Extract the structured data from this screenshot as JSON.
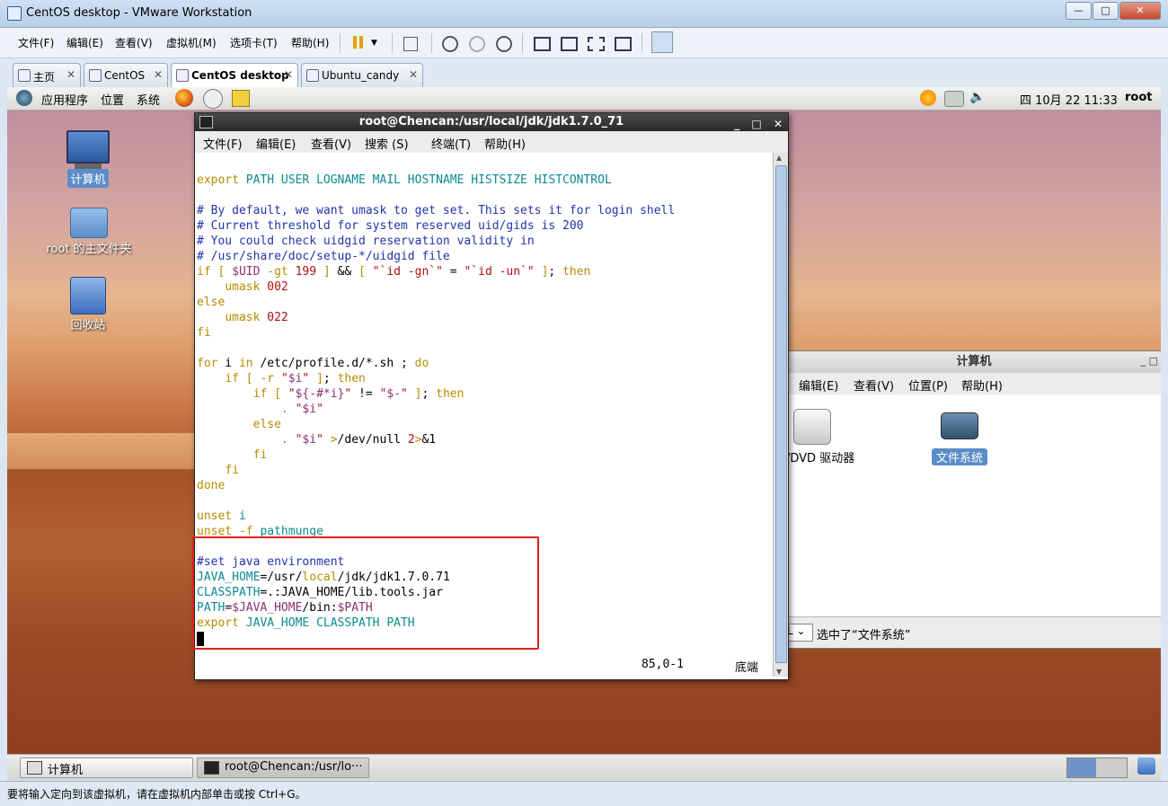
{
  "window": {
    "title": "CentOS desktop - VMware Workstation"
  },
  "vm_menu": [
    "文件(F)",
    "编辑(E)",
    "查看(V)",
    "虚拟机(M)",
    "选项卡(T)",
    "帮助(H)"
  ],
  "tabs": [
    {
      "label": "主页"
    },
    {
      "label": "CentOS"
    },
    {
      "label": "CentOS desktop"
    },
    {
      "label": "Ubuntu_candy"
    }
  ],
  "guest_panel": {
    "menus": [
      "应用程序",
      "位置",
      "系统"
    ],
    "clock": "四 10月 22 11:33",
    "user": "root"
  },
  "desktop_icons": [
    "计算机",
    "root 的主文件夹",
    "回收站"
  ],
  "file_manager": {
    "title": "计算机",
    "menu": [
      "编辑(E)",
      "查看(V)",
      "位置(P)",
      "帮助(H)"
    ],
    "items": [
      "/DVD 驱动器",
      "文件系统"
    ],
    "status_select": "L",
    "status_text": "选中了“文件系统”"
  },
  "terminal": {
    "title": "root@Chencan:/usr/local/jdk/jdk1.7.0_71",
    "menu": [
      "文件(F)",
      "编辑(E)",
      "查看(V)",
      "搜索 (S)",
      "终端(T)",
      "帮助(H)"
    ],
    "position": "85,0-1",
    "scroll_pos": "底端"
  },
  "taskbar": [
    {
      "label": "计算机"
    },
    {
      "label": "root@Chencan:/usr/lo···"
    }
  ],
  "statusbar": {
    "message": "要将输入定向到该虚拟机，请在虚拟机内部单击或按 Ctrl+G。"
  }
}
